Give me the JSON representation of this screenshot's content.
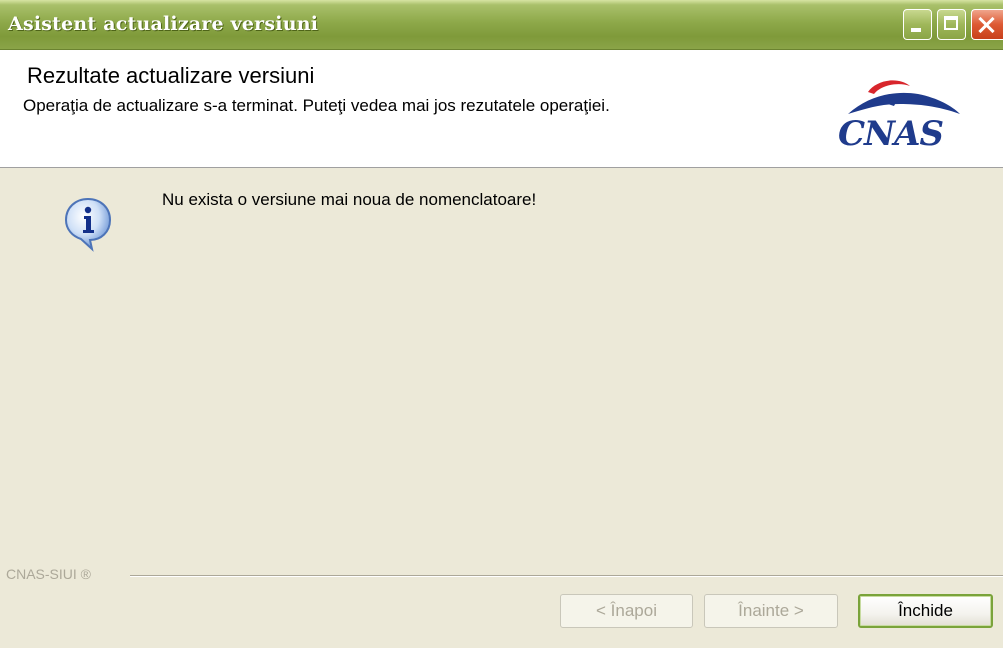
{
  "window": {
    "title": "Asistent actualizare versiuni",
    "controls": {
      "minimize_icon": "minimize-icon",
      "maximize_icon": "maximize-icon",
      "close_icon": "close-icon"
    }
  },
  "header": {
    "title": "Rezultate actualizare versiuni",
    "subtitle": "Operaţia de actualizare s-a terminat. Puteţi vedea mai jos rezutatele operaţiei.",
    "logo_text": "CNAS"
  },
  "content": {
    "icon": "info-icon",
    "message": "Nu exista o versiune mai noua de nomenclatoare!"
  },
  "footer": {
    "label": "CNAS-SIUI ®",
    "back_label": "< Înapoi",
    "next_label": "Înainte >",
    "close_label": "Închide"
  },
  "colors": {
    "titlebar": "#8ea94a",
    "background": "#ece9d8",
    "logo_blue": "#1f3b8c",
    "logo_red": "#d8262c"
  }
}
